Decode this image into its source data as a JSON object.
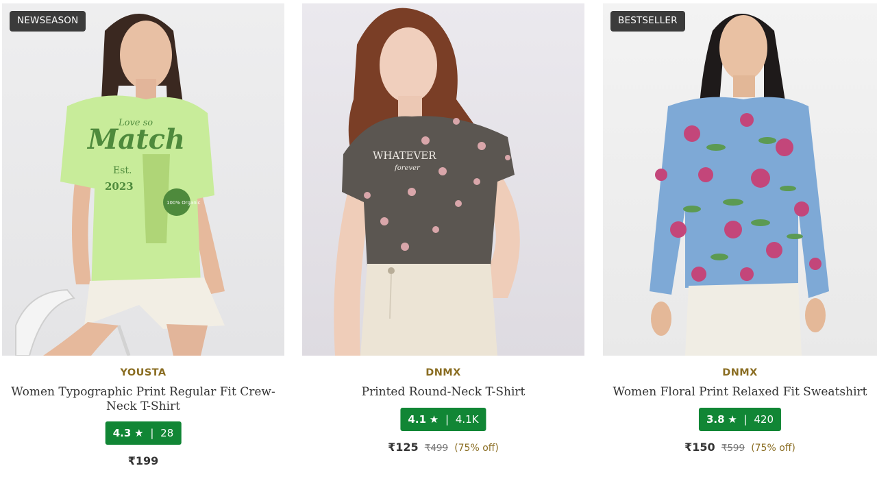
{
  "products": [
    {
      "tag": "NEWSEASON",
      "brand": "YOUSTA",
      "title": "Women Typographic Print Regular Fit Crew-Neck T-Shirt",
      "rating": "4.3",
      "star": "★",
      "sep": "|",
      "reviews": "28",
      "price": "₹199",
      "mrp": "",
      "discount": "",
      "image_text": {
        "line1": "Love so",
        "line2": "Match",
        "line3": "Est.",
        "line4": "2023",
        "line5": "100% Organic"
      },
      "colors": {
        "shirt": "#c8ec9a",
        "print": "#4e8a3c",
        "shorts": "#f2eee4"
      }
    },
    {
      "tag": "",
      "brand": "DNMX",
      "title": "Printed Round-Neck T-Shirt",
      "rating": "4.1",
      "star": "★",
      "sep": "|",
      "reviews": "4.1K",
      "price": "₹125",
      "mrp": "₹499",
      "discount": "(75% off)",
      "image_text": {
        "line1": "WHATEVER",
        "line2": "forever"
      },
      "colors": {
        "shirt": "#5b5651",
        "print": "#d9a6aa",
        "jeans": "#ece4d5"
      }
    },
    {
      "tag": "BESTSELLER",
      "brand": "DNMX",
      "title": "Women Floral Print Relaxed Fit Sweatshirt",
      "rating": "3.8",
      "star": "★",
      "sep": "|",
      "reviews": "420",
      "price": "₹150",
      "mrp": "₹599",
      "discount": "(75% off)",
      "colors": {
        "sweatshirt": "#7ea9d6",
        "flower": "#c3467a",
        "leaf": "#5c9a52",
        "pants": "#f0ede4"
      }
    }
  ],
  "accent": {
    "brand_text": "#8a6d22",
    "rating_bg": "#118635",
    "tag_bg": "#3b3b3b"
  }
}
